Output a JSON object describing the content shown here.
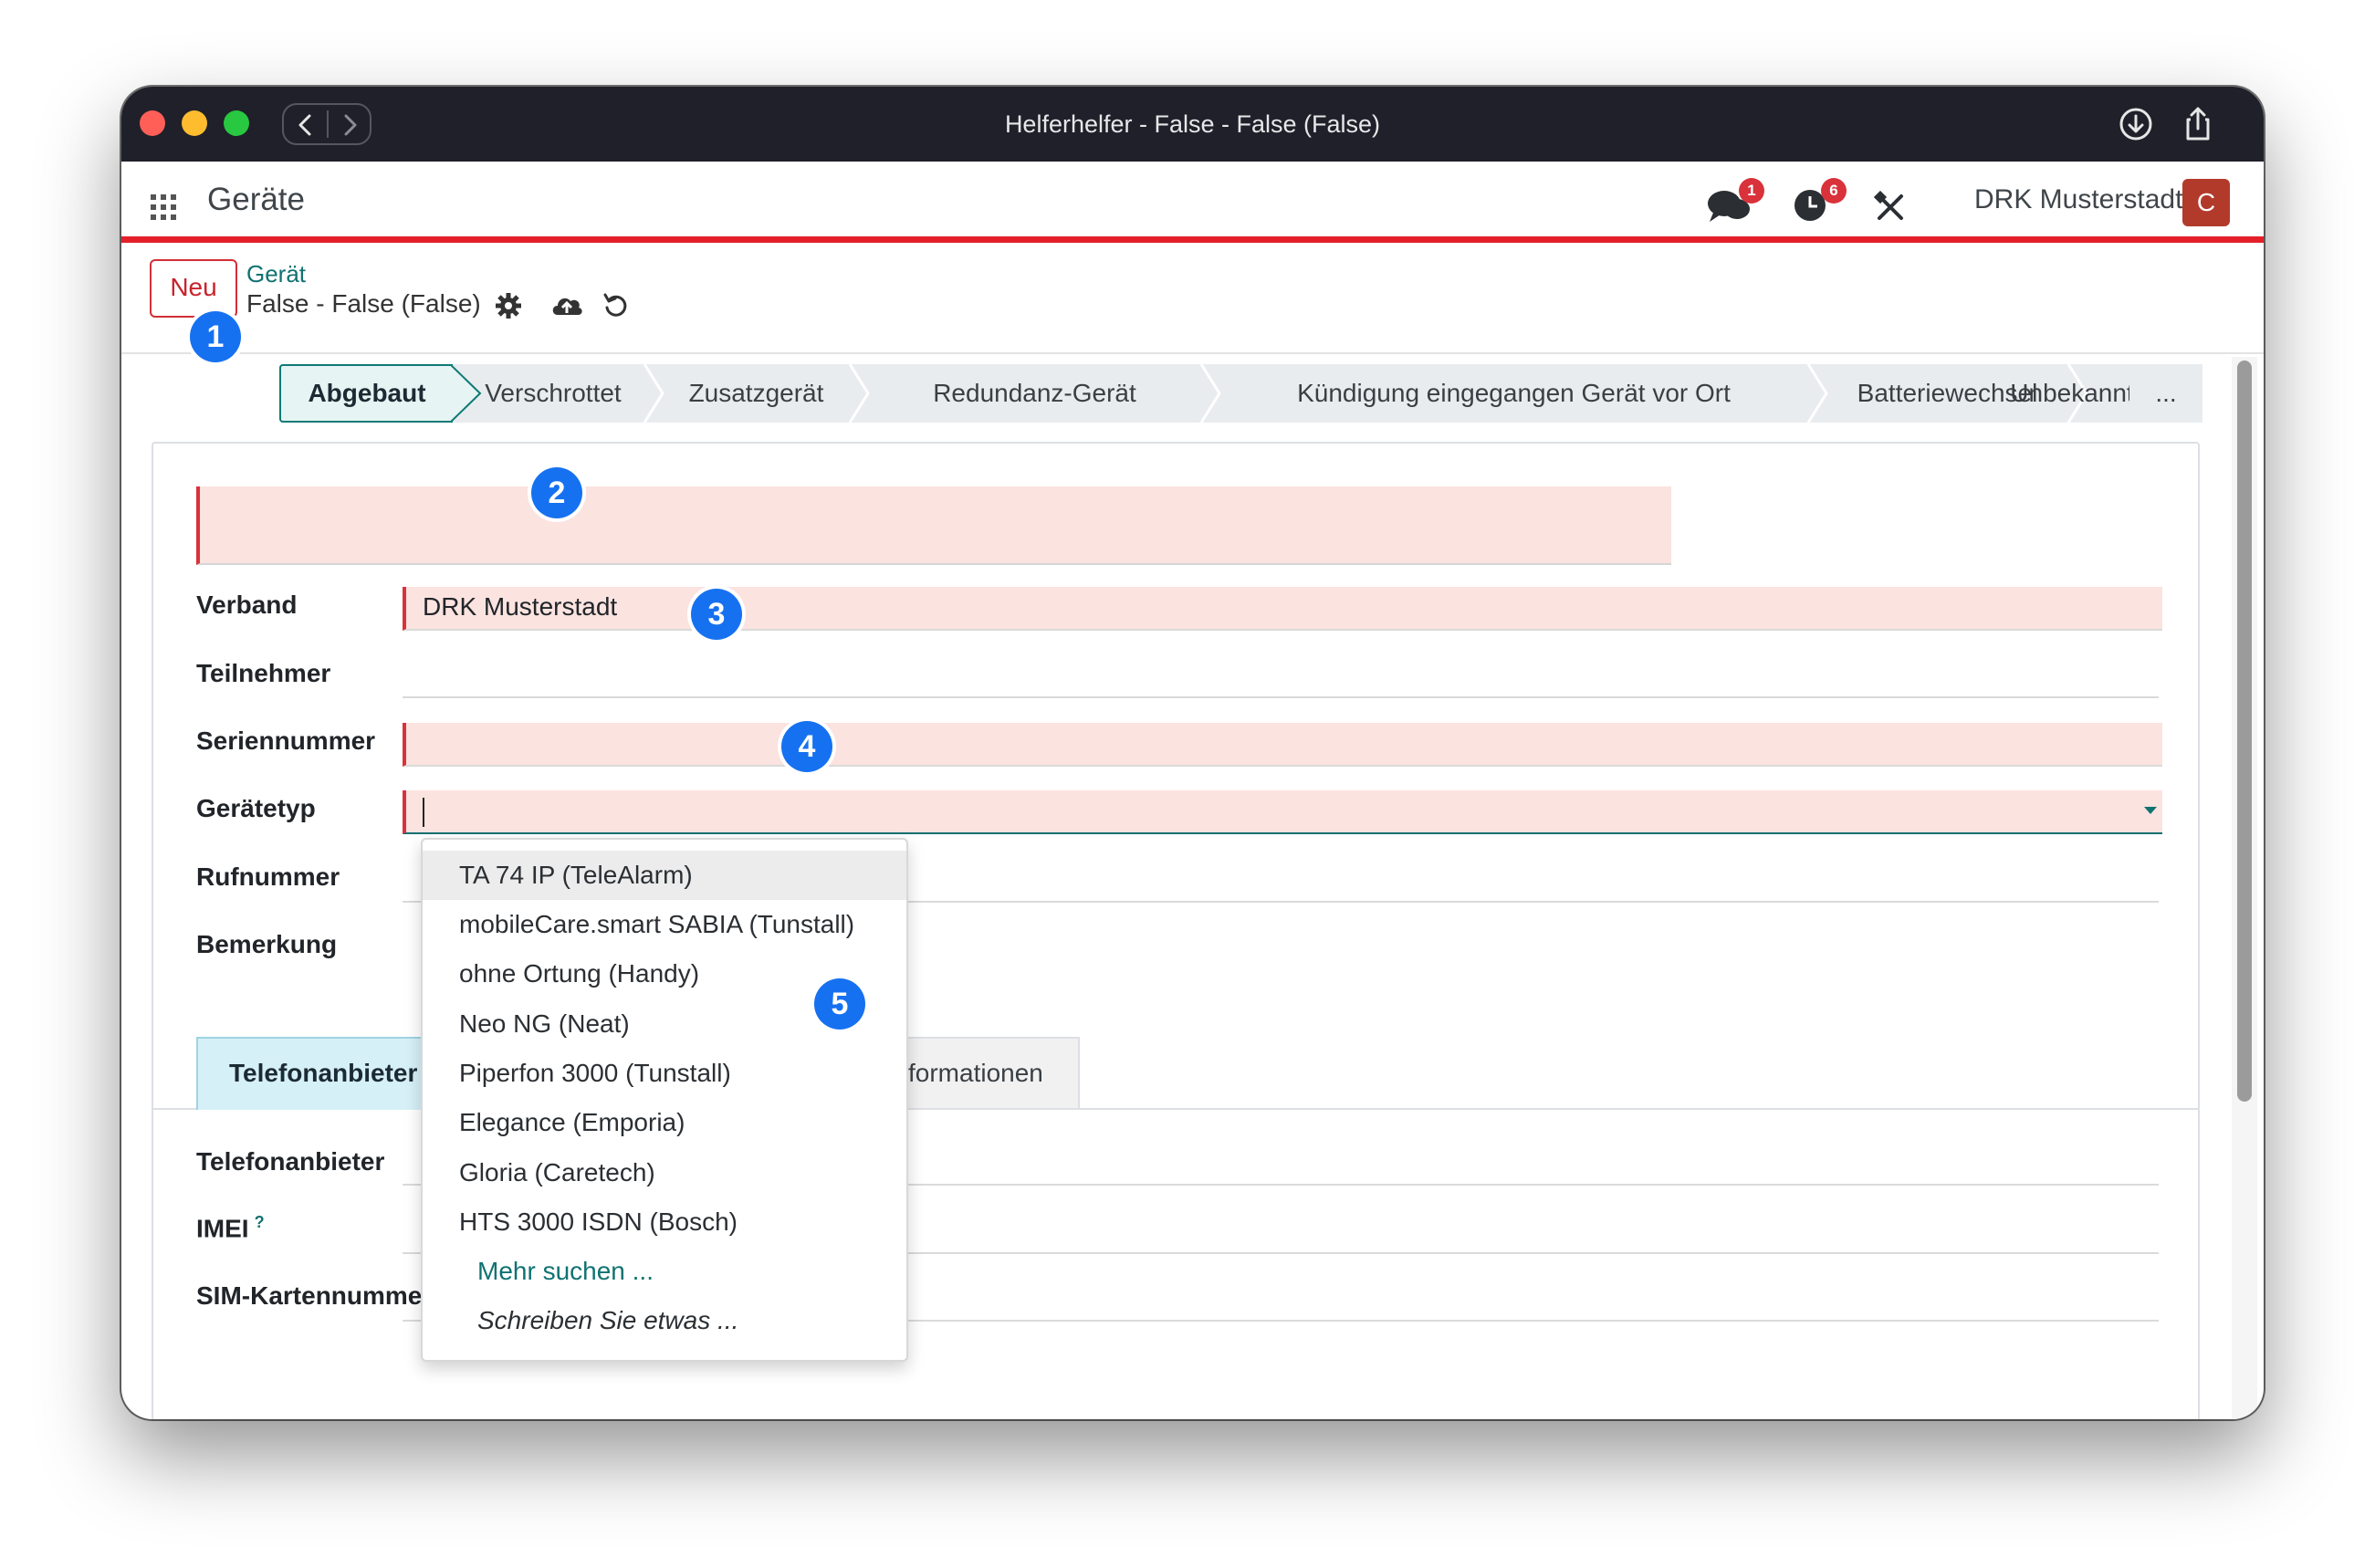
{
  "window": {
    "title": "Helferhelfer - False - False (False)"
  },
  "header": {
    "app_title": "Geräte",
    "messages_count": "1",
    "activities_count": "6",
    "company": "DRK Musterstadt",
    "avatar_initial": "C"
  },
  "control": {
    "new_button": "Neu",
    "breadcrumb_parent": "Gerät",
    "record_name": "False - False (False)"
  },
  "annotations": [
    "1",
    "2",
    "3",
    "4",
    "5"
  ],
  "statusbar": {
    "stages": [
      "Abgebaut",
      "Verschrottet",
      "Zusatzgerät",
      "Redundanz-Gerät",
      "Kündigung eingegangen Gerät vor Ort",
      "Batteriewechsel",
      "Unbekannt",
      "..."
    ],
    "active_index": 0
  },
  "form": {
    "fields": [
      {
        "label": "Verband",
        "value": "DRK Musterstadt"
      },
      {
        "label": "Teilnehmer",
        "value": ""
      },
      {
        "label": "Seriennummer",
        "value": ""
      },
      {
        "label": "Gerätetyp",
        "value": ""
      },
      {
        "label": "Rufnummer",
        "value": ""
      },
      {
        "label": "Bemerkung",
        "value": ""
      }
    ]
  },
  "tabs": {
    "active": "Telefonanbieter",
    "other": "formationen"
  },
  "tab_fields": [
    {
      "label": "Telefonanbieter"
    },
    {
      "label": "IMEI",
      "help": "?"
    },
    {
      "label": "SIM-Kartennumme"
    }
  ],
  "dropdown": {
    "options": [
      "TA 74 IP (TeleAlarm)",
      "mobileCare.smart SABIA (Tunstall)",
      "ohne Ortung (Handy)",
      "Neo NG (Neat)",
      "Piperfon 3000 (Tunstall)",
      "Elegance (Emporia)",
      "Gloria (Caretech)",
      "HTS 3000 ISDN (Bosch)"
    ],
    "search_more": "Mehr suchen ...",
    "write_something": "Schreiben Sie etwas ..."
  },
  "colors": {
    "brand_red": "#e3202a",
    "required_bg": "#fbe3e0",
    "accent_teal": "#107271",
    "badge_blue": "#1671f0"
  }
}
